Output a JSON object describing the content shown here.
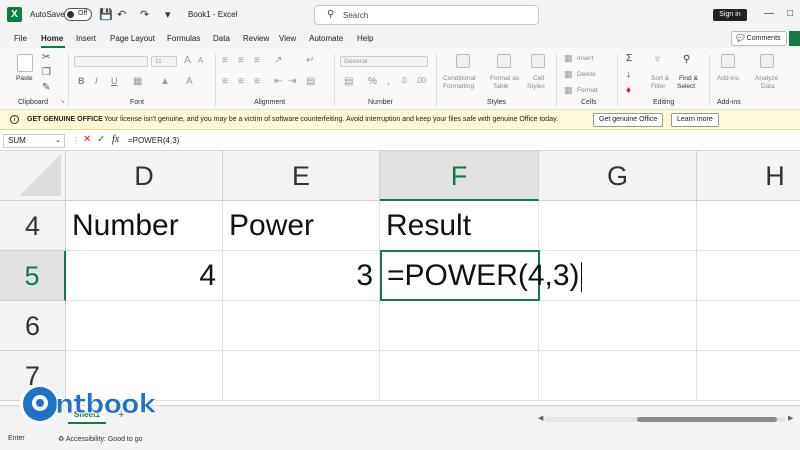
{
  "titlebar": {
    "autosave_label": "AutoSave",
    "autosave_state": "Off",
    "doc_title": "Book1 - Excel",
    "search_placeholder": "Search",
    "signin_label": "Sign in"
  },
  "menu": {
    "tabs": [
      "File",
      "Home",
      "Insert",
      "Page Layout",
      "Formulas",
      "Data",
      "Review",
      "View",
      "Automate",
      "Help"
    ],
    "active_tab": "Home",
    "comments_label": "Comments"
  },
  "ribbon": {
    "clipboard": {
      "label": "Clipboard",
      "paste": "Paste"
    },
    "font": {
      "label": "Font",
      "font_size": "11",
      "bold": "B",
      "italic": "I",
      "underline": "U"
    },
    "alignment": {
      "label": "Alignment"
    },
    "number": {
      "label": "Number",
      "format": "General",
      "percent": "%"
    },
    "styles": {
      "label": "Styles",
      "conditional": [
        "Conditional",
        "Formatting"
      ],
      "format_table": [
        "Format as",
        "Table"
      ],
      "cell_styles": [
        "Cell",
        "Styles"
      ]
    },
    "cells": {
      "label": "Cells",
      "insert": "Insert",
      "delete": "Delete",
      "format": "Format"
    },
    "editing": {
      "label": "Editing",
      "sort": [
        "Sort &",
        "Filter"
      ],
      "find": [
        "Find &",
        "Select"
      ]
    },
    "addins": {
      "label": "Add-ins",
      "addins": "Add-ins",
      "analyze": [
        "Analyze",
        "Data"
      ]
    }
  },
  "notice": {
    "title": "GET GENUINE OFFICE",
    "message": "Your license isn't genuine, and you may be a victim of software counterfeiting. Avoid interruption and keep your files safe with genuine Office today.",
    "primary_button": "Get genuine Office",
    "secondary_button": "Learn more"
  },
  "formula_bar": {
    "name_box": "SUM",
    "cancel_icon": "✕",
    "enter_icon": "✓",
    "fx_label": "fx",
    "content": "=POWER(4,3)"
  },
  "grid": {
    "columns": [
      "D",
      "E",
      "F",
      "G",
      "H"
    ],
    "rows": [
      "4",
      "5",
      "6",
      "7"
    ],
    "active_column": "F",
    "active_row": "5",
    "cells": {
      "D4": "Number",
      "E4": "Power",
      "F4": "Result",
      "D5": "4",
      "E5": "3",
      "F5": "=POWER(4,3)"
    }
  },
  "watermark": {
    "brand": "ntbook"
  },
  "sheets": {
    "tabs": [
      "Sheet1"
    ],
    "add_icon": "+"
  },
  "statusbar": {
    "mode": "Enter",
    "accessibility": "Accessibility: Good to go"
  },
  "colors": {
    "excel_green": "#107c41",
    "notice_bg": "#fff8d6",
    "watermark_blue": "#1e73c8"
  }
}
